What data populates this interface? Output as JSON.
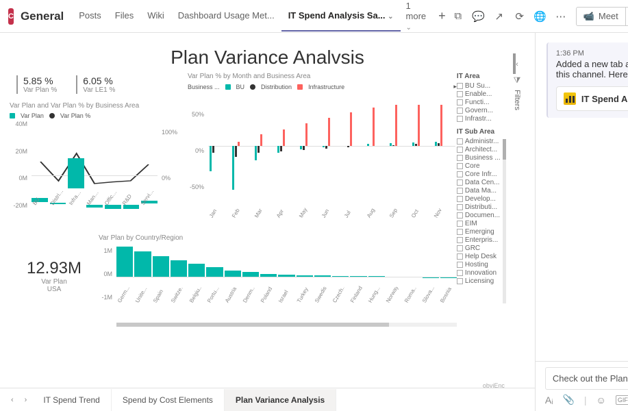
{
  "header": {
    "team_initial": "C",
    "channel": "General",
    "tabs": [
      "Posts",
      "Files",
      "Wiki",
      "Dashboard Usage Met...",
      "IT Spend Analysis Sa..."
    ],
    "active_tab_index": 4,
    "more_label": "1 more",
    "meet_label": "Meet"
  },
  "report": {
    "title": "Plan Variance Analvsis",
    "kpis": [
      {
        "value": "5.85 %",
        "label": "Var Plan %"
      },
      {
        "value": "6.05 %",
        "label": "Var LE1 %"
      }
    ],
    "combo": {
      "title": "Var Plan and Var Plan % by Business Area",
      "legend": [
        {
          "name": "Var Plan",
          "color": "teal"
        },
        {
          "name": "Var Plan %",
          "color": "black"
        }
      ],
      "yleft": [
        "40M",
        "20M",
        "0M",
        "-20M"
      ],
      "yright": [
        "100%",
        "0%"
      ]
    },
    "spark": {
      "title": "Var Plan % by Month and Business Area",
      "legend_prefix": "Business ...",
      "legend": [
        {
          "name": "BU",
          "color": "teal"
        },
        {
          "name": "Distribution",
          "color": "black"
        },
        {
          "name": "Infrastructure",
          "color": "orange"
        }
      ],
      "y": [
        "50%",
        "0%",
        "-50%"
      ]
    },
    "big_kpi": {
      "value": "12.93M",
      "sub1": "Var Plan",
      "sub2": "USA"
    },
    "country": {
      "title": "Var Plan by Country/Region",
      "y": [
        "1M",
        "0M",
        "-1M"
      ]
    },
    "slicers": {
      "area_title": "IT Area",
      "area_items": [
        "BU Su...",
        "Enable...",
        "Functi...",
        "Govern...",
        "Infrastr..."
      ],
      "sub_title": "IT Sub Area",
      "sub_items": [
        "Administr...",
        "Architect...",
        "Business ...",
        "Core",
        "Core Infr...",
        "Data Cen...",
        "Data Ma...",
        "Develop...",
        "Distributi...",
        "Documen...",
        "EIM",
        "Emerging",
        "Enterpris...",
        "GRC",
        "Help Desk",
        "Hosting",
        "Innovation",
        "Licensing"
      ]
    },
    "filters_label": "Filters",
    "watermark": "obviEnc",
    "footer_tabs": [
      "IT Spend Trend",
      "Spend by Cost Elements",
      "Plan Variance Analysis"
    ],
    "footer_active": 2
  },
  "chat": {
    "time": "1:36 PM",
    "message": "Added a new tab at the top of this channel. Here's a link.",
    "attachment_label": "IT Spend An...",
    "compose_value": "Check out the Plan Variance analysis"
  },
  "chart_data": [
    {
      "type": "bar",
      "title": "Var Plan and Var Plan % by Business Area",
      "categories": [
        "BU",
        "Distribution",
        "Infrastructure",
        "Manufacturing",
        "Office & Administ...",
        "R&D",
        "Services"
      ],
      "series": [
        {
          "name": "Var Plan",
          "values": [
            3,
            1,
            22,
            -2,
            -3,
            -3,
            2
          ],
          "unit": "M"
        },
        {
          "name": "Var Plan %",
          "values": [
            25,
            -10,
            40,
            -15,
            -12,
            -10,
            20
          ],
          "unit": "%"
        }
      ],
      "ylim": [
        -20,
        40
      ],
      "y2lim": [
        -50,
        100
      ]
    },
    {
      "type": "bar",
      "title": "Var Plan % by Month and Business Area",
      "categories": [
        "Jan",
        "Feb",
        "Mar",
        "Apr",
        "May",
        "Jun",
        "Jul",
        "Aug",
        "Sep",
        "Oct",
        "Nov"
      ],
      "series": [
        {
          "name": "BU",
          "values": [
            -35,
            -60,
            -20,
            -10,
            -5,
            -2,
            0,
            2,
            3,
            4,
            5
          ]
        },
        {
          "name": "Distribution",
          "values": [
            -10,
            -15,
            -10,
            -8,
            -6,
            -4,
            -2,
            0,
            1,
            2,
            3
          ]
        },
        {
          "name": "Infrastructure",
          "values": [
            0,
            5,
            15,
            22,
            30,
            38,
            45,
            52,
            55,
            55,
            55
          ]
        }
      ],
      "ylim": [
        -70,
        60
      ],
      "ylabel": "%"
    },
    {
      "type": "bar",
      "title": "Var Plan by Country/Region",
      "categories": [
        "Germ...",
        "Unite...",
        "Spain",
        "Switze...",
        "Belgiu...",
        "Portu...",
        "Austria",
        "Denm...",
        "Poland",
        "Israel",
        "Turkey",
        "Swedish",
        "Czech...",
        "Finland",
        "Hung...",
        "Norway",
        "Roma...",
        "Slova...",
        "Bosnia"
      ],
      "values": [
        1.3,
        1.1,
        0.9,
        0.7,
        0.55,
        0.4,
        0.25,
        0.2,
        0.1,
        0.08,
        0.05,
        0.04,
        0.03,
        0.02,
        0.02,
        -0.05,
        -0.05,
        -0.06,
        -0.08
      ],
      "unit": "M",
      "ylim": [
        -1,
        1.4
      ]
    }
  ]
}
